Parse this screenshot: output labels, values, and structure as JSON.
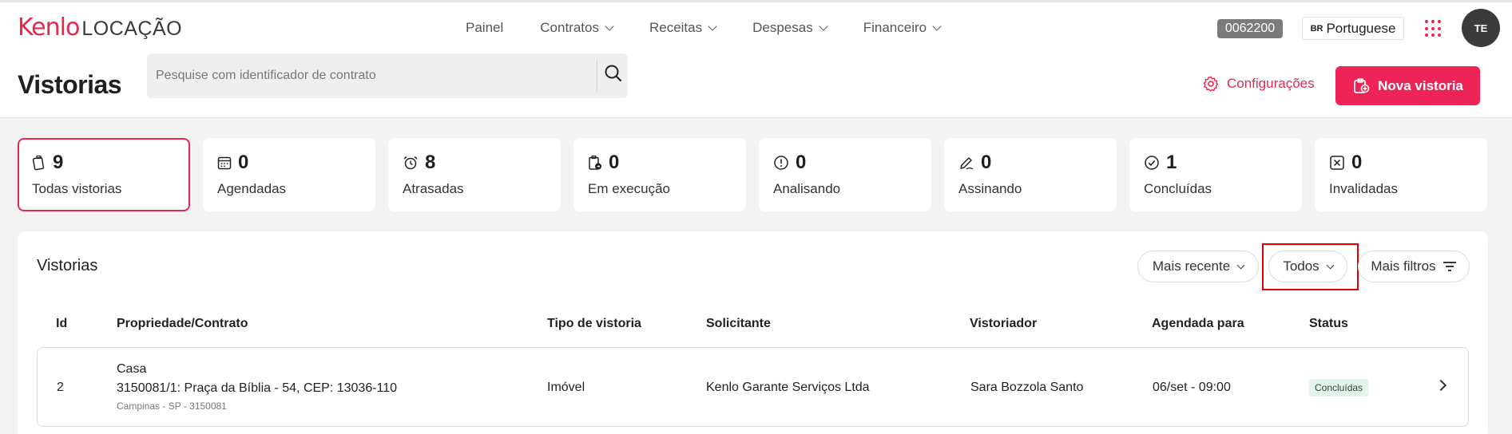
{
  "header": {
    "brand": "Kenlo",
    "brand_sub": "LOCAÇÃO",
    "nav": [
      {
        "label": "Painel"
      },
      {
        "label": "Contratos"
      },
      {
        "label": "Receitas"
      },
      {
        "label": "Despesas"
      },
      {
        "label": "Financeiro"
      }
    ],
    "account_code": "0062200",
    "language_flag": "BR",
    "language": "Portuguese",
    "avatar_initials": "TE"
  },
  "page": {
    "title": "Vistorias",
    "search_placeholder": "Pesquise com identificador de contrato",
    "settings_label": "Configurações",
    "new_button_label": "Nova vistoria"
  },
  "stats": [
    {
      "count": "9",
      "label": "Todas vistorias",
      "icon": "inspection-icon",
      "active": true
    },
    {
      "count": "0",
      "label": "Agendadas",
      "icon": "calendar-icon"
    },
    {
      "count": "8",
      "label": "Atrasadas",
      "icon": "alarm-clock-icon"
    },
    {
      "count": "0",
      "label": "Em execução",
      "icon": "clipboard-progress-icon"
    },
    {
      "count": "0",
      "label": "Analisando",
      "icon": "alert-circle-icon"
    },
    {
      "count": "0",
      "label": "Assinando",
      "icon": "pen-icon"
    },
    {
      "count": "1",
      "label": "Concluídas",
      "icon": "check-circle-icon"
    },
    {
      "count": "0",
      "label": "Invalidadas",
      "icon": "x-square-icon"
    }
  ],
  "list": {
    "title": "Vistorias",
    "sort_label": "Mais recente",
    "status_filter_label": "Todos",
    "more_filters_label": "Mais filtros",
    "columns": [
      "Id",
      "Propriedade/Contrato",
      "Tipo de vistoria",
      "Solicitante",
      "Vistoriador",
      "Agendada para",
      "Status"
    ],
    "rows": [
      {
        "id": "2",
        "property_type": "Casa",
        "contract": "3150081/1: Praça da Bíblia - 54, CEP: 13036-110",
        "location": "Campinas - SP - 3150081",
        "inspection_type": "Imóvel",
        "requester": "Kenlo Garante Serviços Ltda",
        "inspector": "Sara Bozzola Santo",
        "scheduled": "06/set - 09:00",
        "status": "Concluídas"
      }
    ]
  },
  "colors": {
    "accent": "#e8264f",
    "primary_button": "#ee2457",
    "highlight_box": "#e00000",
    "status_bg": "#e3f2ea"
  }
}
